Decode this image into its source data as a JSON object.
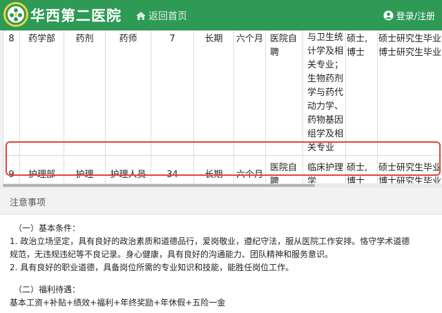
{
  "header": {
    "site_title": "华西第二医院",
    "home_label": "返回首页",
    "user_label": "登录/注册"
  },
  "table": {
    "rows": [
      {
        "no": "8",
        "department": "药学部",
        "category": "药剂",
        "position": "药师",
        "count": "7",
        "term": "长期",
        "probation": "六个月",
        "method": "医院自聘",
        "major": "与卫生统计学及相关专业；生物药剂学与药代动力学、药物基因组学及相关专业",
        "degree": "硕士,博士",
        "education": "硕士研究生毕业 博士研究生毕业"
      },
      {
        "no": "9",
        "department": "护理部",
        "category": "护理",
        "position": "护理人员",
        "count": "34",
        "term": "长期",
        "probation": "六个月",
        "method": "医院自聘",
        "major": "临床护理学",
        "degree": "硕士,博士",
        "education": "硕士研究生毕业 博士研究生毕业"
      }
    ]
  },
  "notice": {
    "title": "注意事项",
    "lines": [
      "（一）基本条件：",
      "1. 政治立场坚定，具有良好的政治素质和道德品行，爱岗敬业，遵纪守法，服从医院工作安排。恪守学术道德",
      "规范，无违规违纪等不良记录。身心健康，具有良好的沟通能力、团队精神和服务意识。",
      "2. 具有良好的职业道德，具备岗位所需的专业知识和技能，能胜任岗位工作。",
      "（二）福利待遇：",
      "基本工资+补贴+绩效+福利+年终奖励+年休假+五险一金"
    ]
  },
  "colors": {
    "header_bg": "#2e9a56",
    "highlight_border": "#d9453c"
  }
}
